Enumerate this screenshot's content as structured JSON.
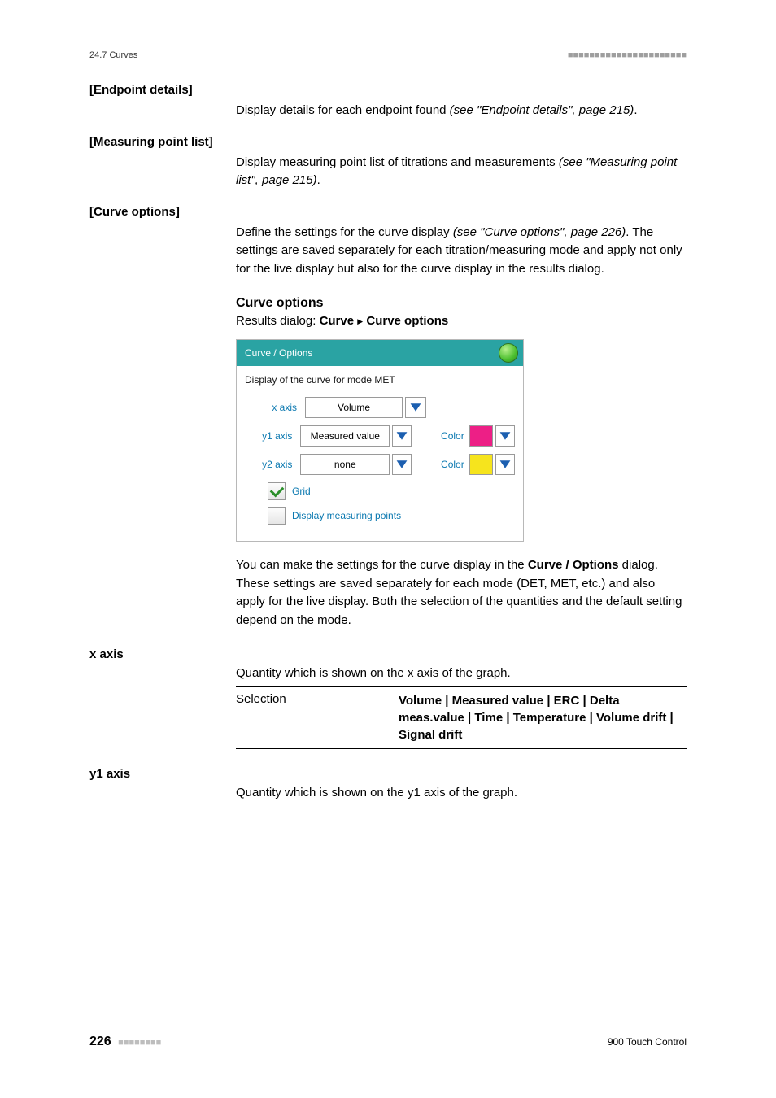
{
  "header": {
    "section": "24.7 Curves",
    "bars": "■■■■■■■■■■■■■■■■■■■■■■"
  },
  "definitions": [
    {
      "label": "[Endpoint details]",
      "body_prefix": "Display details for each endpoint found ",
      "body_italic": "(see \"Endpoint details\", page 215)",
      "body_suffix": "."
    },
    {
      "label": "[Measuring point list]",
      "body_prefix": "Display measuring point list of titrations and measurements ",
      "body_italic": "(see \"Measuring point list\", page 215)",
      "body_suffix": "."
    },
    {
      "label": "[Curve options]",
      "body_prefix": "Define the settings for the curve display ",
      "body_italic": "(see \"Curve options\", page 226)",
      "body_suffix": ". The settings are saved separately for each titration/measuring mode and apply not only for the live display but also for the curve display in the results dialog."
    }
  ],
  "curve_options": {
    "heading": "Curve options",
    "sub_prefix": "Results dialog: ",
    "sub_bold1": "Curve",
    "sub_bold2": "Curve options"
  },
  "dialog": {
    "title": "Curve / Options",
    "subtitle": "Display of the curve for mode MET",
    "rows": {
      "xaxis": {
        "label": "x axis",
        "value": "Volume"
      },
      "y1axis": {
        "label": "y1 axis",
        "value": "Measured value",
        "color_label": "Color"
      },
      "y2axis": {
        "label": "y2 axis",
        "value": "none",
        "color_label": "Color"
      }
    },
    "checks": {
      "grid": "Grid",
      "points": "Display measuring points"
    }
  },
  "after_dialog": {
    "p1_a": "You can make the settings for the curve display in the ",
    "p1_b": "Curve / Options",
    "p1_c": " dialog. These settings are saved separately for each mode (DET, MET, etc.) and also apply for the live display. Both the selection of the quantities and the default setting depend on the mode."
  },
  "axes": {
    "x": {
      "label": "x axis",
      "desc": "Quantity which is shown on the x axis of the graph.",
      "sel_label": "Selection",
      "sel_value": "Volume | Measured value | ERC | Delta meas.value | Time | Temperature | Volume drift | Signal drift"
    },
    "y1": {
      "label": "y1 axis",
      "desc": "Quantity which is shown on the y1 axis of the graph."
    }
  },
  "footer": {
    "page": "226",
    "bars": "■■■■■■■■",
    "product": "900 Touch Control"
  }
}
